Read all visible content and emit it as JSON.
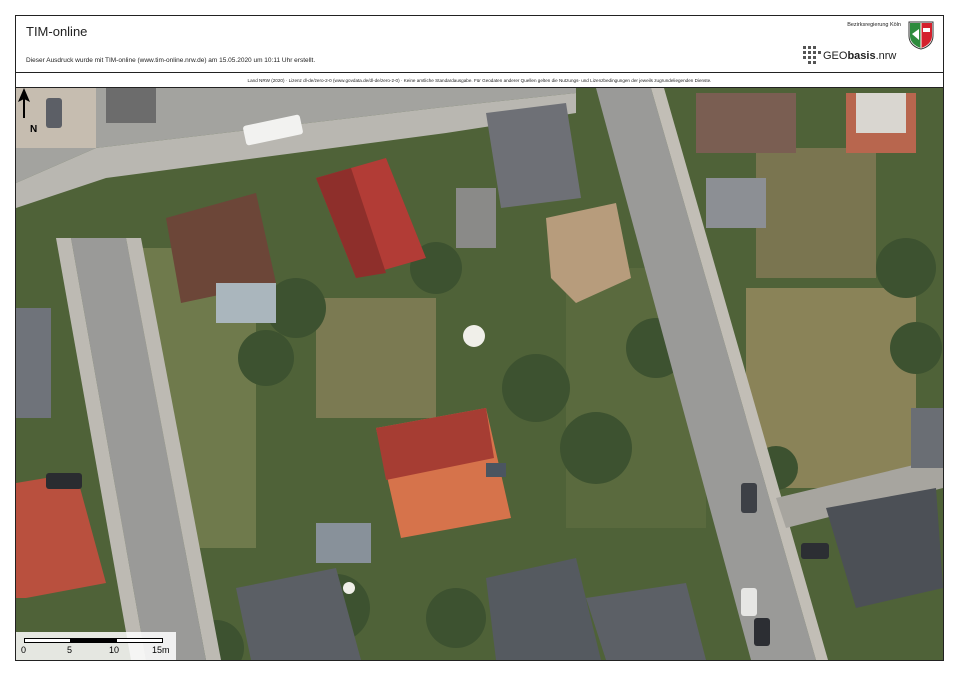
{
  "header": {
    "title": "TIM-online",
    "subtitle": "Dieser Ausdruck wurde mit TIM-online (www.tim-online.nrw.de) am 15.05.2020 um 10:11 Uhr erstellt.",
    "authority": "Bezirksregierung Köln",
    "logo_prefix": "GEO",
    "logo_bold": "basis",
    "logo_suffix": ".nrw"
  },
  "license": "Land NRW (2020) · Lizenz dl-de/zero-2-0 (www.govdata.de/dl-de/zero-2-0) · Keine amtliche Standardausgabe. Für Geodaten anderer Quellen gelten die Nutzungs- und Lizenzbedingungen der jeweils zugrundeliegenden Dienste.",
  "map": {
    "north_label": "N",
    "scale": {
      "labels": [
        "0",
        "5",
        "10",
        "15m"
      ],
      "unit": "m"
    },
    "colors": {
      "road": "#9a9a98",
      "vegetation": "#4f6238",
      "roof_red": "#b4463c",
      "roof_orange": "#d6734b",
      "roof_dark": "#555a60"
    }
  }
}
